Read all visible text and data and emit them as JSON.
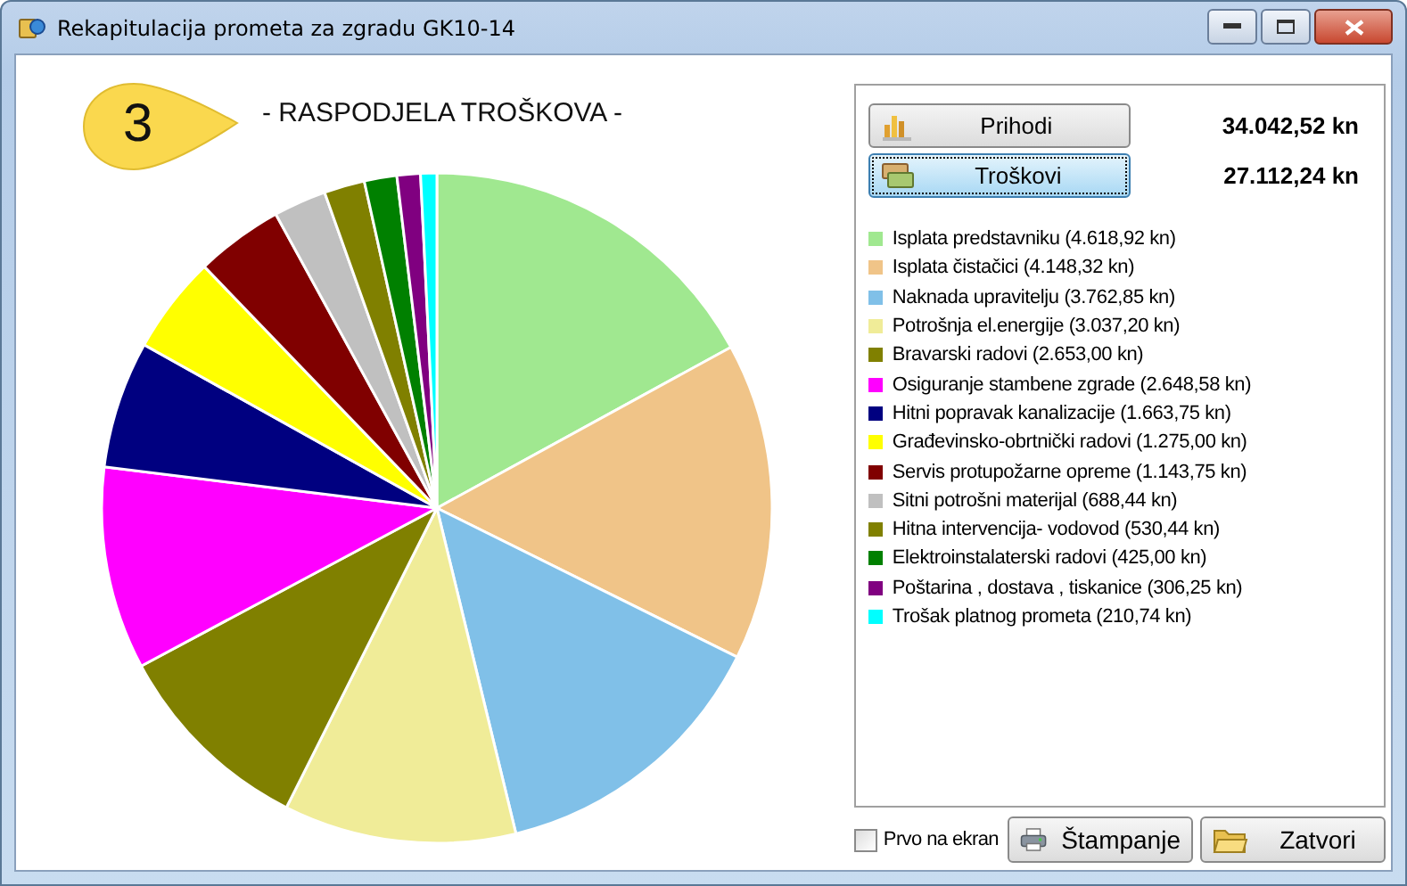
{
  "window": {
    "title": "Rekapitulacija prometa za zgradu GK10-14"
  },
  "step": {
    "number": "3",
    "title": "- RASPODJELA TROŠKOVA -"
  },
  "totals": [
    {
      "label": "Prihodi",
      "amount": "34.042,52 kn",
      "selected": false
    },
    {
      "label": "Troškovi",
      "amount": "27.112,24 kn",
      "selected": true
    }
  ],
  "legend": [
    {
      "label": "Isplata predstavniku (4.618,92 kn)",
      "color": "#a0e890"
    },
    {
      "label": "Isplata čistačici (4.148,32 kn)",
      "color": "#f0c488"
    },
    {
      "label": "Naknada upravitelju (3.762,85 kn)",
      "color": "#80c0e8"
    },
    {
      "label": "Potrošnja el.energije (3.037,20 kn)",
      "color": "#f0ec98"
    },
    {
      "label": "Bravarski radovi (2.653,00 kn)",
      "color": "#808000"
    },
    {
      "label": "Osiguranje stambene zgrade (2.648,58 kn)",
      "color": "#ff00ff"
    },
    {
      "label": "Hitni popravak kanalizacije (1.663,75 kn)",
      "color": "#000080"
    },
    {
      "label": "Građevinsko-obrtnički radovi (1.275,00 kn)",
      "color": "#ffff00"
    },
    {
      "label": "Servis protupožarne opreme (1.143,75 kn)",
      "color": "#800000"
    },
    {
      "label": "Sitni potrošni materijal (688,44 kn)",
      "color": "#c0c0c0"
    },
    {
      "label": "Hitna intervencija- vodovod (530,44 kn)",
      "color": "#808000"
    },
    {
      "label": "Elektroinstalaterski radovi (425,00 kn)",
      "color": "#008000"
    },
    {
      "label": "Poštarina , dostava , tiskanice (306,25 kn)",
      "color": "#800080"
    },
    {
      "label": "Trošak platnog prometa (210,74 kn)",
      "color": "#00ffff"
    }
  ],
  "chart_data": {
    "type": "pie",
    "values": [
      17.03,
      15.3,
      13.88,
      11.2,
      9.78,
      9.77,
      6.14,
      4.7,
      4.22,
      2.54,
      1.96,
      1.57,
      1.13,
      0.78
    ]
  },
  "footer": {
    "checkbox": {
      "label": "Prvo na ekran",
      "checked": false
    },
    "buttons": [
      {
        "label": "Štampanje"
      },
      {
        "label": "Zatvori"
      }
    ]
  }
}
